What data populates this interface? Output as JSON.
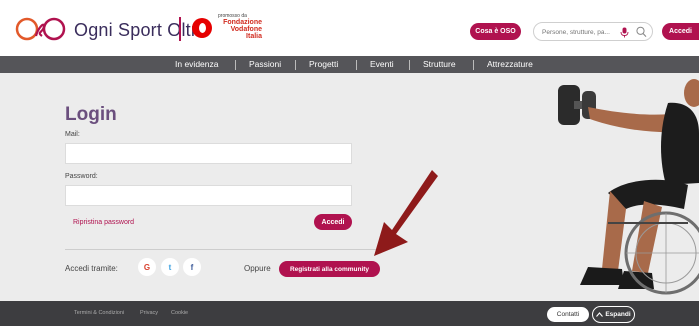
{
  "header": {
    "brand": "Ogni Sport Oltre",
    "promoter": "promosso da",
    "foundation": [
      "Fondazione",
      "Vodafone",
      "Italia"
    ],
    "oso_button": "Cosa è OSO",
    "search_placeholder": "Persone, strutture, pa...",
    "login_button": "Accedi"
  },
  "nav": {
    "items": [
      "In evidenza",
      "Passioni",
      "Progetti",
      "Eventi",
      "Strutture",
      "Attrezzature"
    ]
  },
  "login": {
    "title": "Login",
    "mail_label": "Mail:",
    "password_label": "Password:",
    "reset_link": "Ripristina password",
    "submit": "Accedi",
    "social_label": "Accedi tramite:",
    "social": [
      "G",
      "t",
      "f"
    ],
    "or": "Oppure",
    "register": "Registrati alla community"
  },
  "footer": {
    "links": [
      "Termini & Condizioni",
      "Privacy",
      "Cookie"
    ],
    "contacts": "Contatti",
    "expand": "Espandi"
  },
  "colors": {
    "accent": "#b0124f",
    "nav_bg": "#555559",
    "footer_bg": "#3d3d40",
    "title": "#6b4f7e",
    "arrow": "#8e1a1a"
  }
}
